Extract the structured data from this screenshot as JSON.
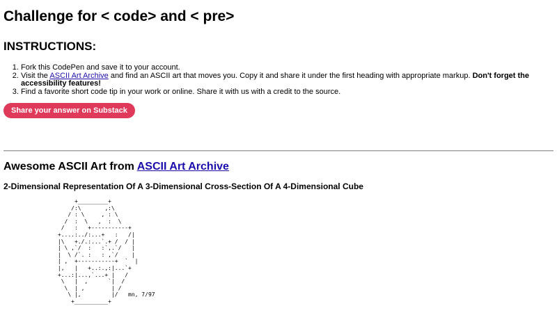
{
  "page": {
    "title": "Challenge for < code> and < pre>"
  },
  "instructions": {
    "heading": "INSTRUCTIONS:",
    "item1": "Fork this CodePen and save it to your account.",
    "item2_prefix": "Visit the ",
    "item2_link": "ASCII Art Archive",
    "item2_middle": " and find an ASCII art that moves you. Copy it and share it under the first heading with appropriate markup. ",
    "item2_bold": "Don't forget the accessibility features!",
    "item3": "Find a favorite short code tip in your work or online. Share it with us with a credit to the source."
  },
  "cta": {
    "label": "Share your answer on Substack"
  },
  "art_section": {
    "heading_prefix": "Awesome ASCII Art from ",
    "heading_link": "ASCII Art Archive",
    "subtitle": "2-Dimensional Representation Of A 3-Dimensional Cross-Section Of A 4-Dimensional Cube",
    "ascii": "           +_________+\n          /:\\       ,:\\\n         / : \\     , : \\\n        /  :  \\   ,  :  \\\n       /   :   +-----------+\n      +....:../:...+   :   /|\n      |\\   +./.:...`.+ /  / |\n      | \\ ,`/  :   :`,.`/   |\n      |  \\ /`. :   : ,`/    |\n      | ,  +-----------+  `  |\n      |,   |   +..:.,:|...`+\n      +...:|...,`...+ |   /\n       \\   |  ,      `|  /\n        \\  | ,        | /\n         \\ |,         |/   mn, 7/97\n          +__________+"
  }
}
